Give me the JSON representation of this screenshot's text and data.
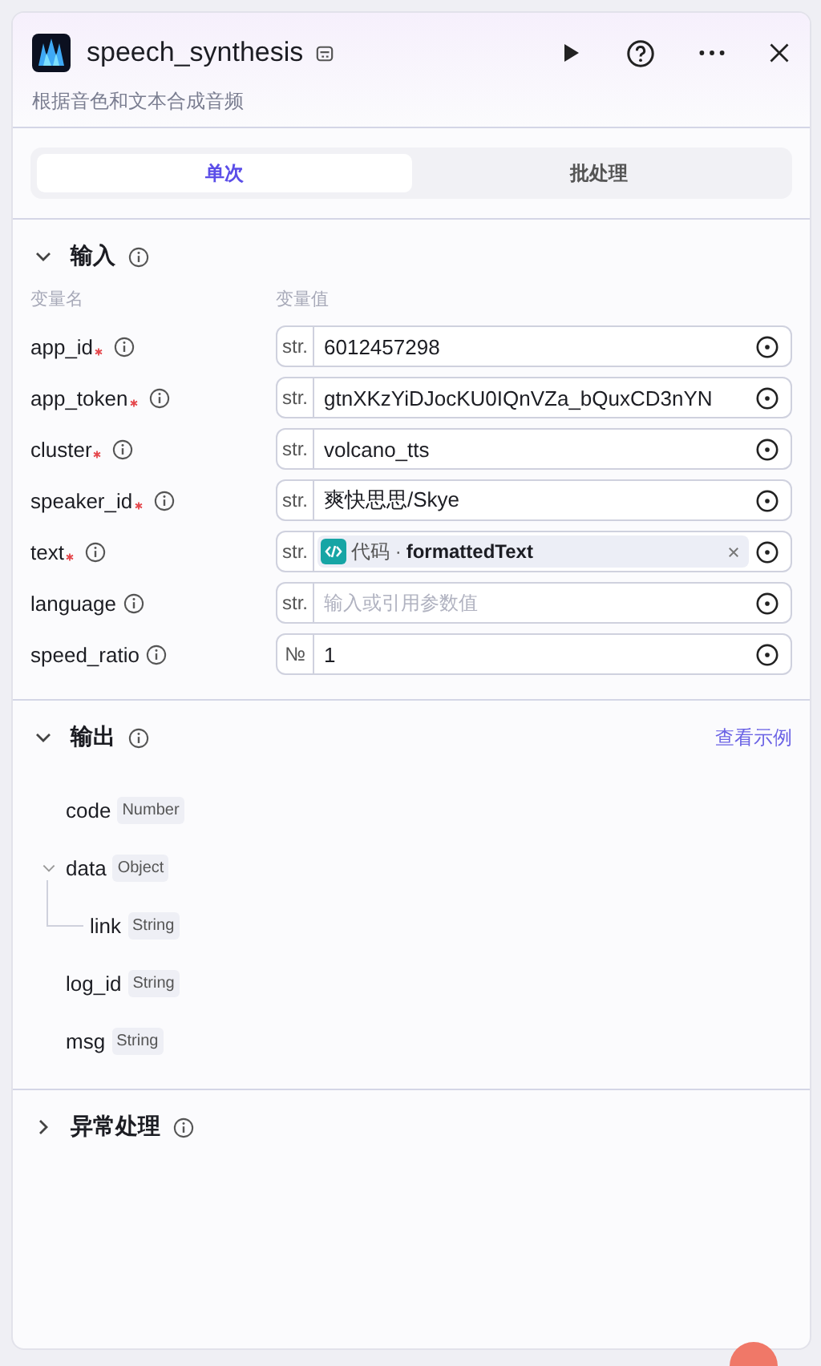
{
  "header": {
    "title": "speech_synthesis",
    "description": "根据音色和文本合成音频"
  },
  "tabs": [
    {
      "label": "单次",
      "selected": true
    },
    {
      "label": "批处理",
      "selected": false
    }
  ],
  "inputs": {
    "title": "输入",
    "expanded": true,
    "column_headers": [
      "变量名",
      "变量值"
    ],
    "params": [
      {
        "name": "app_id",
        "required": true,
        "type": "str.",
        "kind": "value",
        "value": "6012457298"
      },
      {
        "name": "app_token",
        "required": true,
        "type": "str.",
        "kind": "value",
        "value": "gtnXKzYiDJocKU0IQnVZa_bQuxCD3nYN"
      },
      {
        "name": "cluster",
        "required": true,
        "type": "str.",
        "kind": "value",
        "value": "volcano_tts"
      },
      {
        "name": "speaker_id",
        "required": true,
        "type": "str.",
        "kind": "value",
        "value": "爽快思思/Skye"
      },
      {
        "name": "text",
        "required": true,
        "type": "str.",
        "kind": "reference",
        "source": "代码",
        "separator": "·",
        "variable": "formattedText"
      },
      {
        "name": "language",
        "required": false,
        "type": "str.",
        "kind": "empty",
        "placeholder": "输入或引用参数值"
      },
      {
        "name": "speed_ratio",
        "required": false,
        "type": "№",
        "kind": "value",
        "value": "1"
      }
    ]
  },
  "outputs": {
    "title": "输出",
    "expanded": true,
    "example_link": "查看示例",
    "fields": [
      {
        "name": "code",
        "type": "Number"
      },
      {
        "name": "data",
        "type": "Object",
        "expanded": true,
        "children": [
          {
            "name": "link",
            "type": "String"
          }
        ]
      },
      {
        "name": "log_id",
        "type": "String"
      },
      {
        "name": "msg",
        "type": "String"
      }
    ]
  },
  "exception": {
    "title": "异常处理",
    "expanded": false
  }
}
